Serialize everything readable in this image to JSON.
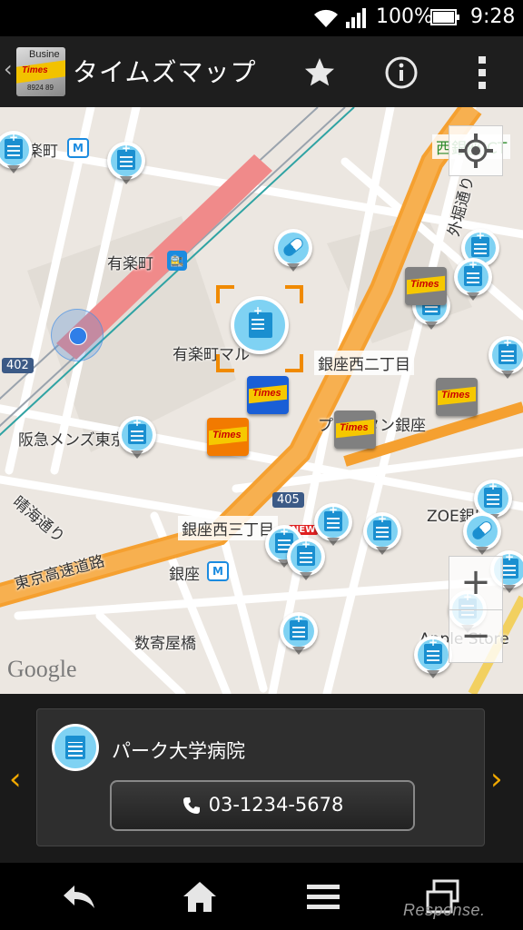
{
  "status_bar": {
    "battery": "100%",
    "time": "9:28"
  },
  "app_bar": {
    "logo_text": "Busine",
    "logo_brand": "Times",
    "logo_number": "8924 89",
    "title": "タイムズマップ"
  },
  "map": {
    "labels": {
      "rakucho": "楽町",
      "yurakucho": "有楽町",
      "yurakucho_mall": "有楽町マル",
      "ginza_nishi_2": "銀座西二丁目",
      "ginza_nishi_3": "銀座西三丁目",
      "hankyu_mens": "阪急メンズ東京",
      "printemps_ginza": "プランタン銀座",
      "zoe_ginza": "ZOE銀座",
      "harumi_dori": "晴海通り",
      "tokyo_expressway": "東京高速道路",
      "ginza": "銀座",
      "sukiyabashi": "数寄屋橋",
      "sotobori_dori": "外堀通り",
      "nishi_ginza": "西銀座JCT",
      "apple_store": "Apple Store"
    },
    "route_402": "402",
    "route_405": "405",
    "new_badge": "NEW",
    "times_label": "Times",
    "google": "Google",
    "zoom_in": "+",
    "zoom_out": "−"
  },
  "info_card": {
    "name": "パーク大学病院",
    "phone": "03-1234-5678"
  },
  "watermark": "Response."
}
